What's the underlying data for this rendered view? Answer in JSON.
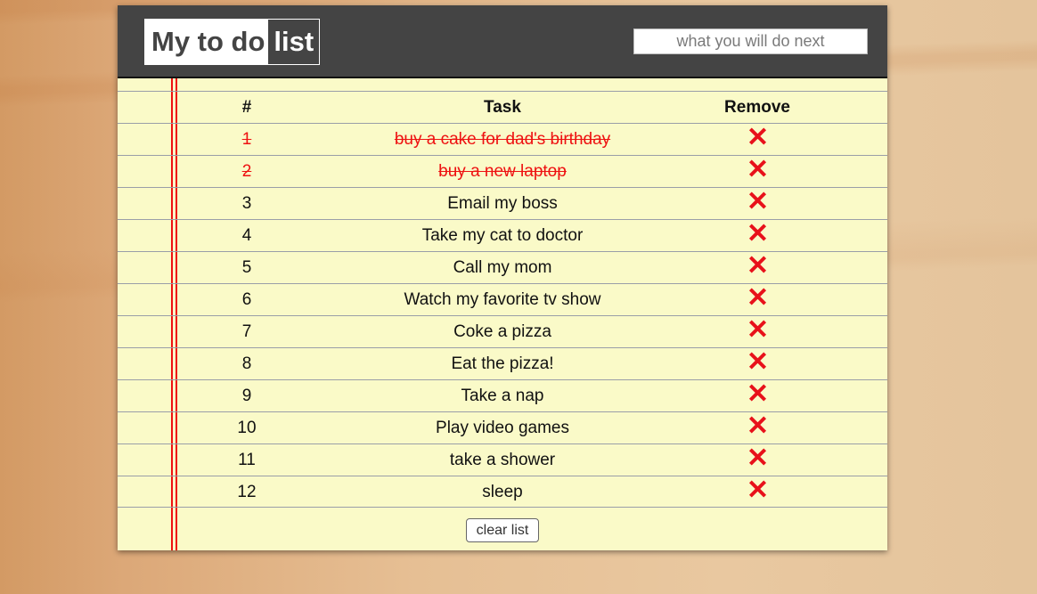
{
  "header": {
    "logo_part1": "My to do",
    "logo_part2": "list",
    "new_task_placeholder": "what you will do next",
    "new_task_value": ""
  },
  "table": {
    "columns": [
      "#",
      "Task",
      "Remove"
    ],
    "rows": [
      {
        "num": "1",
        "task": "buy a cake for dad's birthday",
        "done": true,
        "remove_icon": "red-x-icon"
      },
      {
        "num": "2",
        "task": "buy a new laptop",
        "done": true,
        "remove_icon": "red-x-icon"
      },
      {
        "num": "3",
        "task": "Email my boss",
        "done": false,
        "remove_icon": "red-x-icon"
      },
      {
        "num": "4",
        "task": "Take my cat to doctor",
        "done": false,
        "remove_icon": "red-x-icon"
      },
      {
        "num": "5",
        "task": "Call my mom",
        "done": false,
        "remove_icon": "red-x-icon"
      },
      {
        "num": "6",
        "task": "Watch my favorite tv show",
        "done": false,
        "remove_icon": "red-x-icon"
      },
      {
        "num": "7",
        "task": "Coke a pizza",
        "done": false,
        "remove_icon": "red-x-icon"
      },
      {
        "num": "8",
        "task": "Eat the pizza!",
        "done": false,
        "remove_icon": "red-x-icon"
      },
      {
        "num": "9",
        "task": "Take a nap",
        "done": false,
        "remove_icon": "red-x-icon"
      },
      {
        "num": "10",
        "task": "Play video games",
        "done": false,
        "remove_icon": "red-x-icon"
      },
      {
        "num": "11",
        "task": "take a shower",
        "done": false,
        "remove_icon": "red-x-icon"
      },
      {
        "num": "12",
        "task": "sleep",
        "done": false,
        "remove_icon": "red-x-icon"
      }
    ]
  },
  "footer": {
    "clear_label": "clear list"
  },
  "colors": {
    "header_bg": "#444444",
    "paper_bg": "#fafac8",
    "done_text": "#ee1111",
    "remove_icon": "#e8111a",
    "margin_line": "#ee1111"
  }
}
